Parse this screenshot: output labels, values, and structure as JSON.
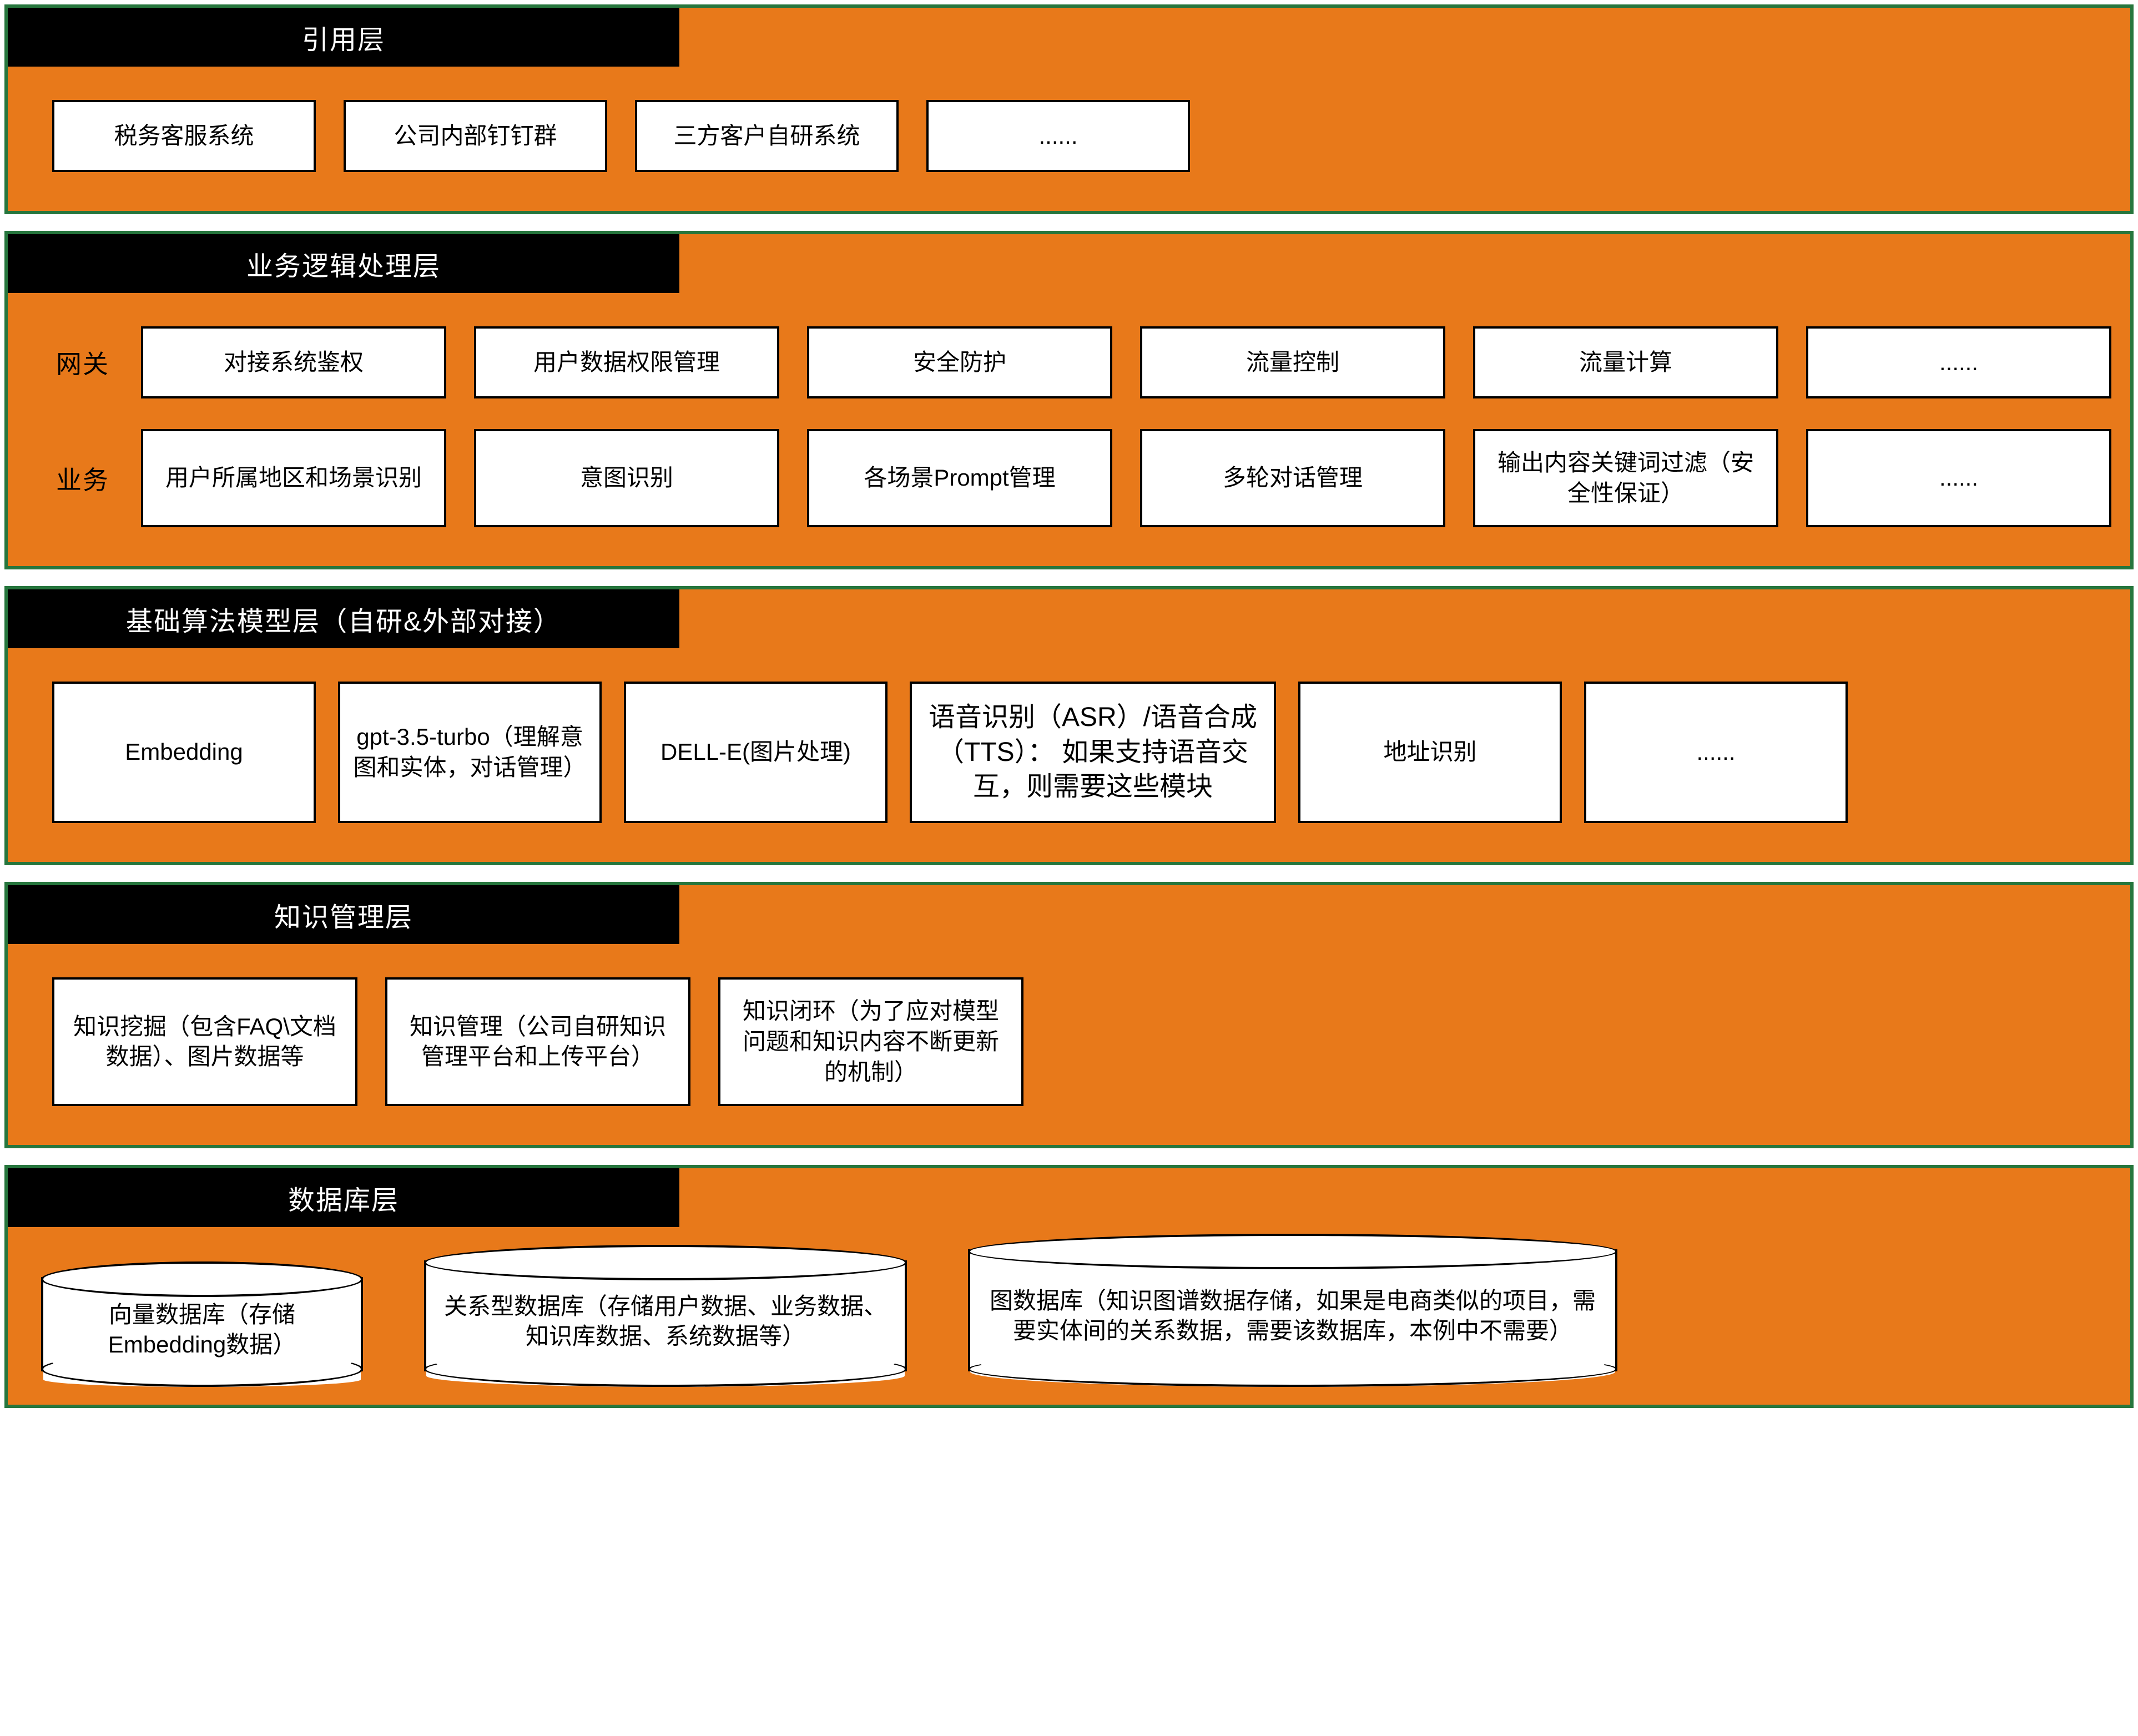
{
  "layers": [
    {
      "title": "引用层",
      "rows": [
        {
          "label": null,
          "boxes": [
            "税务客服系统",
            "公司内部钉钉群",
            "三方客户自研系统",
            "......"
          ]
        }
      ]
    },
    {
      "title": "业务逻辑处理层",
      "rows": [
        {
          "label": "网关",
          "boxes": [
            "对接系统鉴权",
            "用户数据权限管理",
            "安全防护",
            "流量控制",
            "流量计算",
            "......"
          ]
        },
        {
          "label": "业务",
          "boxes": [
            "用户所属地区和场景识别",
            "意图识别",
            "各场景Prompt管理",
            "多轮对话管理",
            "输出内容关键词过滤（安全性保证）",
            "......"
          ]
        }
      ]
    },
    {
      "title": "基础算法模型层（自研&外部对接）",
      "rows": [
        {
          "label": null,
          "boxes": [
            "Embedding",
            "gpt-3.5-turbo（理解意图和实体，对话管理）",
            "DELL-E(图片处理)",
            "语音识别（ASR）/语音合成（TTS）： 如果支持语音交互，则需要这些模块",
            "地址识别",
            "......"
          ]
        }
      ]
    },
    {
      "title": "知识管理层",
      "rows": [
        {
          "label": null,
          "boxes": [
            "知识挖掘（包含FAQ\\文档数据）、图片数据等",
            "知识管理（公司自研知识管理平台和上传平台）",
            "知识闭环（为了应对模型问题和知识内容不断更新的机制）"
          ]
        }
      ]
    },
    {
      "title": "数据库层",
      "databases": [
        "向量数据库（存储Embedding数据）",
        "关系型数据库（存储用户数据、业务数据、知识库数据、系统数据等）",
        "图数据库（知识图谱数据存储，如果是电商类似的项目，需要实体间的关系数据，需要该数据库，本例中不需要）"
      ]
    }
  ]
}
